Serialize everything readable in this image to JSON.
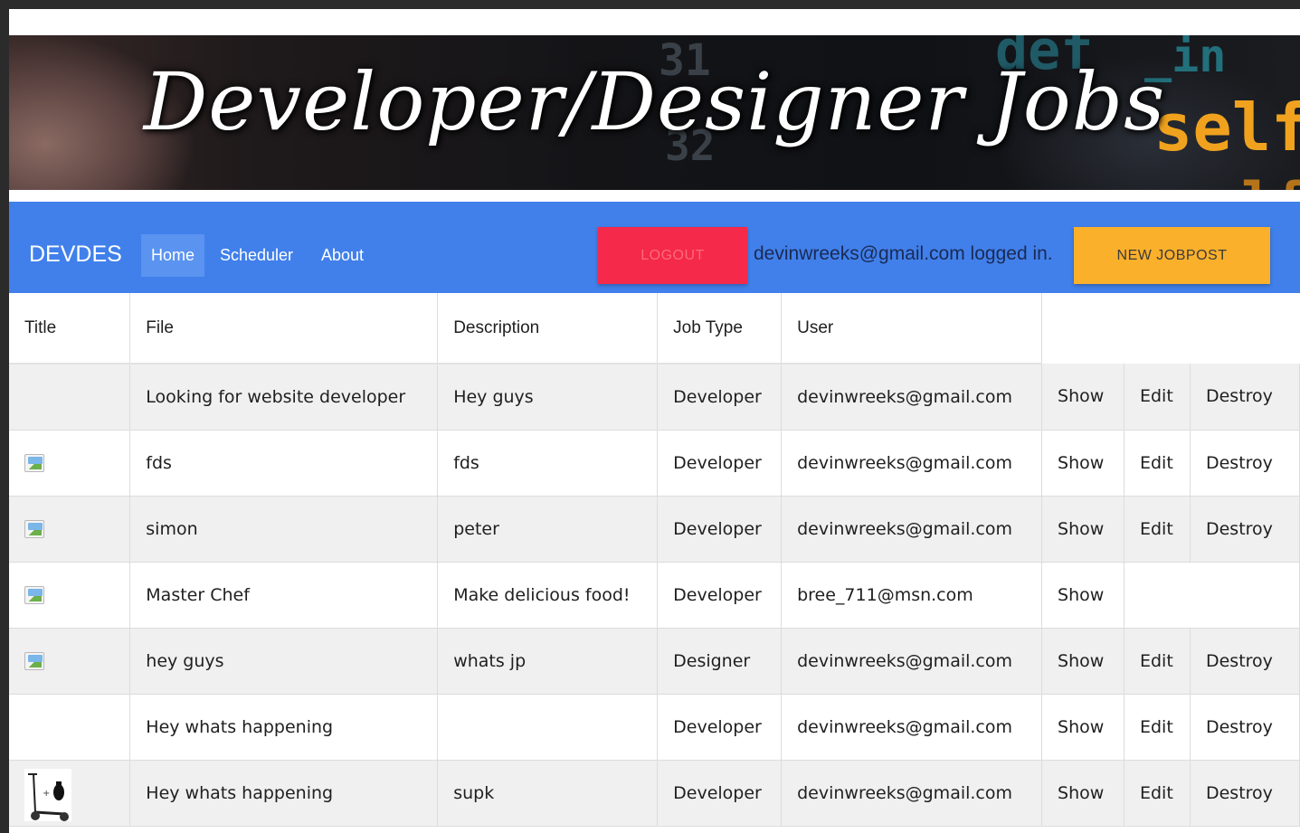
{
  "banner": {
    "title": "Developer/Designer Jobs",
    "code_fragments": [
      "31",
      "32",
      "def",
      "_in",
      "self",
      "self"
    ]
  },
  "navbar": {
    "brand": "DEVDES",
    "links": [
      {
        "label": "Home",
        "active": true
      },
      {
        "label": "Scheduler",
        "active": false
      },
      {
        "label": "About",
        "active": false
      }
    ],
    "logout_label": "LOGOUT",
    "login_status": "devinwreeks@gmail.com logged in.",
    "new_jobpost_label": "NEW JOBPOST",
    "colors": {
      "navbar": "#4180ea",
      "logout": "#f5294a",
      "new_jobpost": "#fbb02b"
    }
  },
  "table": {
    "headers": [
      "Title",
      "File",
      "Description",
      "Job Type",
      "User"
    ],
    "rows": [
      {
        "title_image": "none",
        "file": "Looking for website developer",
        "description": "Hey guys",
        "job_type": "Developer",
        "user": "devinwreeks@gmail.com",
        "show": "Show",
        "edit": "Edit",
        "destroy": "Destroy"
      },
      {
        "title_image": "broken-image-icon",
        "file": "fds",
        "description": "fds",
        "job_type": "Developer",
        "user": "devinwreeks@gmail.com",
        "show": "Show",
        "edit": "Edit",
        "destroy": "Destroy"
      },
      {
        "title_image": "broken-image-icon",
        "file": "simon",
        "description": "peter",
        "job_type": "Developer",
        "user": "devinwreeks@gmail.com",
        "show": "Show",
        "edit": "Edit",
        "destroy": "Destroy"
      },
      {
        "title_image": "broken-image-icon",
        "file": "Master Chef",
        "description": "Make delicious food!",
        "job_type": "Developer",
        "user": "bree_711@msn.com",
        "show": "Show",
        "edit": "",
        "destroy": ""
      },
      {
        "title_image": "broken-image-icon",
        "file": "hey guys",
        "description": "whats jp",
        "job_type": "Designer",
        "user": "devinwreeks@gmail.com",
        "show": "Show",
        "edit": "Edit",
        "destroy": "Destroy"
      },
      {
        "title_image": "none",
        "file": "Hey whats happening",
        "description": "",
        "job_type": "Developer",
        "user": "devinwreeks@gmail.com",
        "show": "Show",
        "edit": "Edit",
        "destroy": "Destroy"
      },
      {
        "title_image": "scooter-thumbnail",
        "file": "Hey whats happening",
        "description": "supk",
        "job_type": "Developer",
        "user": "devinwreeks@gmail.com",
        "show": "Show",
        "edit": "Edit",
        "destroy": "Destroy"
      }
    ]
  }
}
